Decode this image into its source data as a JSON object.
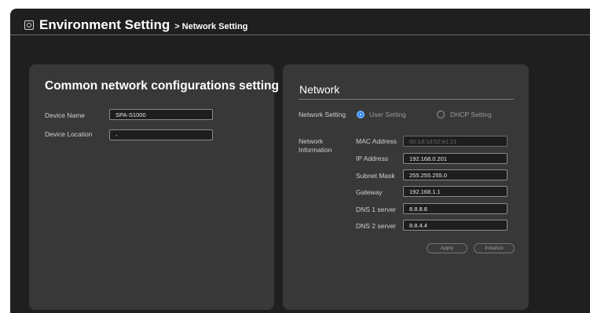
{
  "header": {
    "title": "Environment Setting",
    "separator": ">",
    "breadcrumb": "Network Setting"
  },
  "common": {
    "title": "Common network configurations setting",
    "device_name_label": "Device Name",
    "device_name_value": "SPA-S1000",
    "device_location_label": "Device Location",
    "device_location_value": "-"
  },
  "network": {
    "title": "Network",
    "setting_label": "Network Setting",
    "options": [
      {
        "label": "User Setting",
        "selected": true
      },
      {
        "label": "DHCP Setting",
        "selected": false
      }
    ],
    "info_label_line1": "Network",
    "info_label_line2": "Information",
    "fields": [
      {
        "label": "MAC Address",
        "value": "00:1d:1d:02:e1:21",
        "disabled": true
      },
      {
        "label": "IP Address",
        "value": "192.168.0.201"
      },
      {
        "label": "Subnet Mask",
        "value": "255.255.255.0"
      },
      {
        "label": "Gateway",
        "value": "192.168.1.1"
      },
      {
        "label": "DNS 1 server",
        "value": "8.8.8.8"
      },
      {
        "label": "DNS 2 server",
        "value": "8.8.4.4"
      }
    ],
    "apply_label": "Apply",
    "initialize_label": "Initialize"
  },
  "colors": {
    "background": "#1f1f1f",
    "panel": "#383838",
    "radio_selected": "#2a80e8"
  },
  "icons": {
    "header": "settings-icon"
  }
}
